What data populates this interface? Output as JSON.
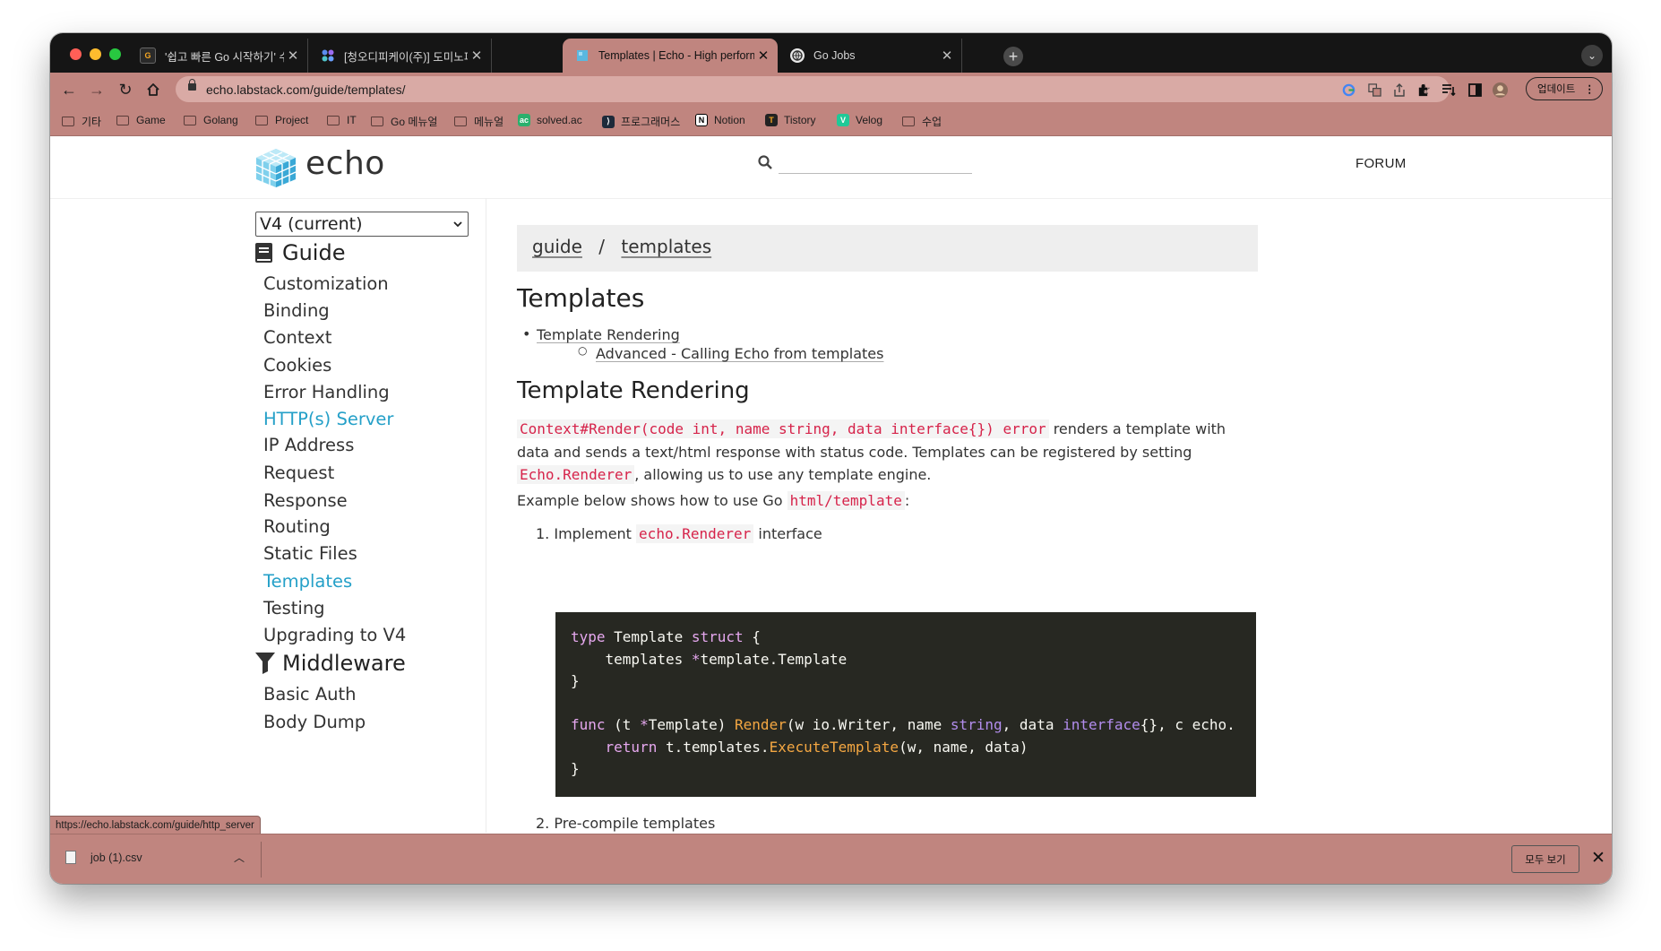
{
  "browser": {
    "tabs": [
      {
        "title": "'쉽고 빠른 Go 시작하기' 수정하기",
        "icon": "go-favicon",
        "active": false
      },
      {
        "title": "[청오디피케이(주)] 도미노피자 각 부문",
        "icon": "dots-favicon",
        "active": false
      },
      {
        "title": "Templates | Echo - High performance",
        "icon": "echo-favicon",
        "active": true
      },
      {
        "title": "Go Jobs",
        "icon": "globe-favicon",
        "active": false
      }
    ],
    "address": "echo.labstack.com/guide/templates/",
    "update_label": "업데이트",
    "bookmarks": [
      {
        "label": "기타",
        "type": "folder"
      },
      {
        "label": "Game",
        "type": "folder"
      },
      {
        "label": "Golang",
        "type": "folder"
      },
      {
        "label": "Project",
        "type": "folder"
      },
      {
        "label": "IT",
        "type": "folder"
      },
      {
        "label": "Go 메뉴얼",
        "type": "folder"
      },
      {
        "label": "메뉴얼",
        "type": "folder"
      },
      {
        "label": "solved.ac",
        "type": "site"
      },
      {
        "label": "프로그래머스",
        "type": "site"
      },
      {
        "label": "Notion",
        "type": "site"
      },
      {
        "label": "Tistory",
        "type": "site"
      },
      {
        "label": "Velog",
        "type": "site"
      },
      {
        "label": "수업",
        "type": "folder"
      }
    ],
    "status_url": "https://echo.labstack.com/guide/http_server",
    "downloads": {
      "file": "job (1).csv",
      "show_all": "모두 보기"
    }
  },
  "site": {
    "logo": "echo",
    "search_placeholder": "",
    "forum": "FORUM"
  },
  "sidebar": {
    "version": "V4 (current)",
    "guide_title": "Guide",
    "guide_items": [
      "Customization",
      "Binding",
      "Context",
      "Cookies",
      "Error Handling",
      "HTTP(s) Server",
      "IP Address",
      "Request",
      "Response",
      "Routing",
      "Static Files",
      "Templates",
      "Testing",
      "Upgrading to V4"
    ],
    "middleware_title": "Middleware",
    "middleware_items": [
      "Basic Auth",
      "Body Dump"
    ]
  },
  "content": {
    "breadcrumb": [
      "guide",
      "templates"
    ],
    "breadcrumb_sep": "/",
    "title": "Templates",
    "toc": [
      "Template Rendering",
      "Advanced - Calling Echo from templates"
    ],
    "section_title": "Template Rendering",
    "para1_code": "Context#Render(code int, name string, data interface{}) error",
    "para1_a": " renders a template with data and sends a text/html response with status code. Templates can be registered by setting ",
    "para1_code2": "Echo.Renderer",
    "para1_b": ", allowing us to use any template engine.",
    "para2_a": "Example below shows how to use Go ",
    "para2_code": "html/template",
    "para2_b": ":",
    "step1_num": "1.",
    "step1_a": "Implement ",
    "step1_code": "echo.Renderer",
    "step1_b": " interface",
    "step2": "2. Pre-compile templates",
    "code": {
      "l1_kw": "type",
      "l1_a": " Template ",
      "l1_kw2": "struct",
      "l1_b": " {",
      "l2_a": "    templates ",
      "l2_star": "*",
      "l2_b": "template.Template",
      "l3": "}",
      "l5_kw": "func",
      "l5_a": " (t ",
      "l5_star": "*",
      "l5_b": "Template) ",
      "l5_fn": "Render",
      "l5_c": "(w io.Writer, name ",
      "l5_ty": "string",
      "l5_d": ", data ",
      "l5_ty2": "interface",
      "l5_e": "{}, c echo.",
      "l6_kw": "    return",
      "l6_a": " t.templates.",
      "l6_fn": "ExecuteTemplate",
      "l6_b": "(w, name, data)",
      "l7": "}"
    }
  },
  "colors": {
    "chrome": "#c0857f",
    "tabstrip": "#151515",
    "link_highlight": "#25a0c8",
    "code_bg": "#272822",
    "inline_code": "#d6234a"
  }
}
